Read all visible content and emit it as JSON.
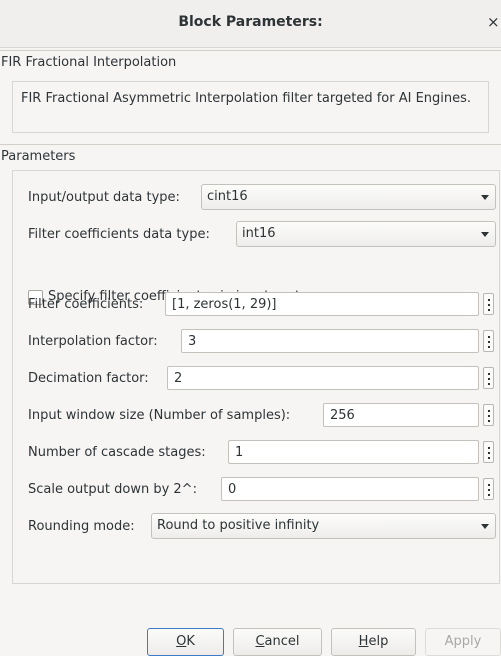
{
  "window": {
    "title": "Block Parameters:",
    "close_glyph": "×"
  },
  "block": {
    "name": "FIR Fractional Interpolation",
    "description": "FIR Fractional Asymmetric Interpolation filter targeted for AI Engines."
  },
  "params_header": "Parameters",
  "params": {
    "io_type": {
      "label": "Input/output data type:",
      "value": "cint16"
    },
    "coef_type": {
      "label": "Filter coefficients data type:",
      "value": "int16"
    },
    "coef_port": {
      "label": "Specify filter coefficients via input port",
      "checked": false
    },
    "coefficients": {
      "label": "Filter coefficients:",
      "value": "[1, zeros(1, 29)]"
    },
    "interp": {
      "label": "Interpolation factor:",
      "value": "3"
    },
    "decim": {
      "label": "Decimation factor:",
      "value": "2"
    },
    "window": {
      "label": "Input window size (Number of samples):",
      "value": "256"
    },
    "cascade": {
      "label": "Number of cascade stages:",
      "value": "1"
    },
    "shift": {
      "label": "Scale output down by 2^:",
      "value": "0"
    },
    "rounding": {
      "label": "Rounding mode:",
      "value": "Round to positive infinity"
    }
  },
  "buttons": {
    "ok": {
      "mnemonic": "O",
      "rest": "K"
    },
    "cancel": {
      "mnemonic": "C",
      "rest": "ancel"
    },
    "help": {
      "mnemonic": "H",
      "rest": "elp"
    },
    "apply": {
      "label": "Apply",
      "enabled": false
    }
  },
  "icons": [
    "close-icon",
    "dropdown-arrow-icon",
    "more-options-icon"
  ]
}
